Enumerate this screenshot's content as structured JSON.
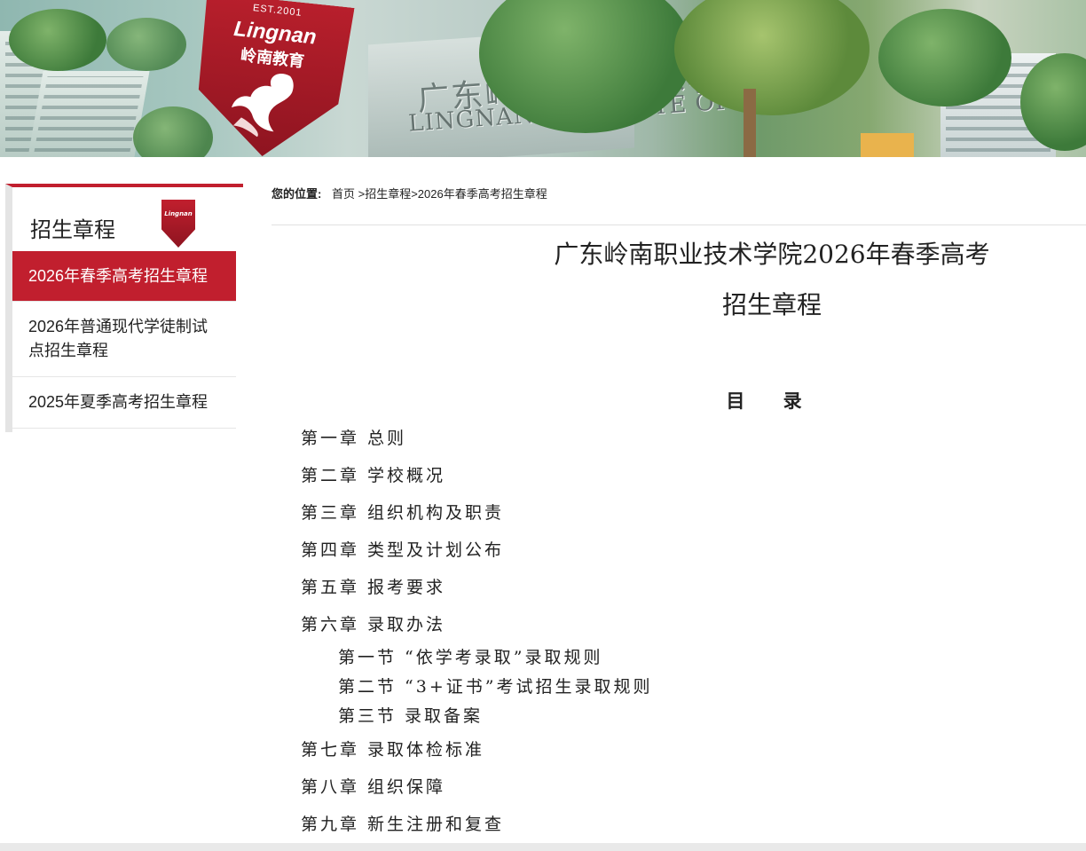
{
  "banner": {
    "logo_est": "EST.2001",
    "logo_en": "Lingnan",
    "logo_cn": "岭南教育",
    "sign_cn": "广东岭南职业技术学院",
    "sign_en": "LINGNAN INSTITUTE OF"
  },
  "sidebar": {
    "title": "招生章程",
    "items": [
      {
        "label": "2026年春季高考招生章程",
        "active": true
      },
      {
        "label": "2026年普通现代学徒制试点招生章程",
        "active": false
      },
      {
        "label": "2025年夏季高考招生章程",
        "active": false
      }
    ]
  },
  "breadcrumb": {
    "label": "您的位置:",
    "home": "首页",
    "path": [
      ">招生章程",
      ">2026年春季高考招生章程"
    ]
  },
  "article": {
    "title_line1": "广东岭南职业技术学院2026年春季高考",
    "title_line2": "招生章程",
    "toc_heading": "目 录",
    "toc": [
      {
        "text": "第一章 总则",
        "level": 1
      },
      {
        "text": "第二章 学校概况",
        "level": 1
      },
      {
        "text": "第三章 组织机构及职责",
        "level": 1
      },
      {
        "text": "第四章 类型及计划公布",
        "level": 1
      },
      {
        "text": "第五章 报考要求",
        "level": 1
      },
      {
        "text": "第六章 录取办法",
        "level": 1
      },
      {
        "text": "第一节 “依学考录取”录取规则",
        "level": 2
      },
      {
        "text": "第二节 “3+证书”考试招生录取规则",
        "level": 2
      },
      {
        "text": "第三节 录取备案",
        "level": 2
      },
      {
        "text": "第七章 录取体检标准",
        "level": 1
      },
      {
        "text": "第八章 组织保障",
        "level": 1
      },
      {
        "text": "第九章 新生注册和复查",
        "level": 1
      }
    ]
  },
  "colors": {
    "accent": "#c11f2e",
    "sidebar_border": "#e4e4e4"
  }
}
